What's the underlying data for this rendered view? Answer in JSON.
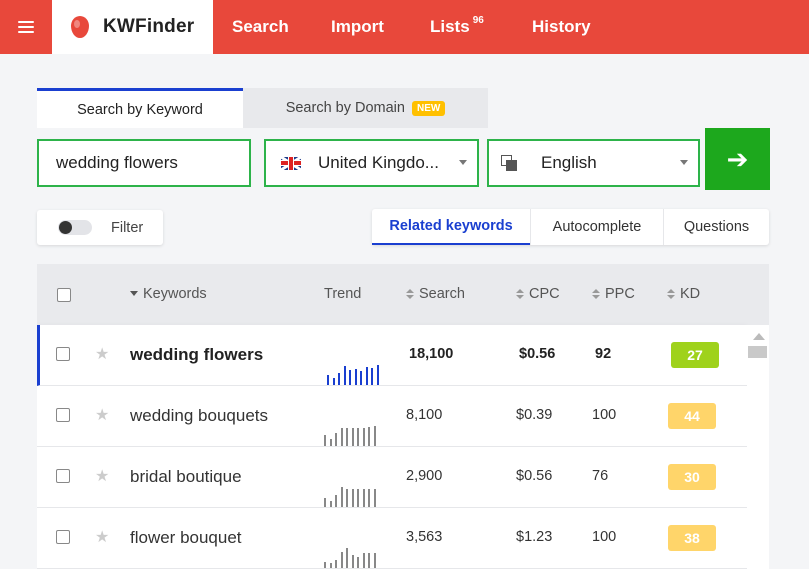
{
  "nav": {
    "brand": "KWFinder",
    "items": [
      {
        "label": "Search"
      },
      {
        "label": "Import"
      },
      {
        "label": "Lists",
        "badge": "96"
      },
      {
        "label": "History"
      }
    ]
  },
  "mode_tabs": {
    "by_keyword": "Search by Keyword",
    "by_domain": "Search by Domain",
    "new_badge": "NEW"
  },
  "search": {
    "keyword": "wedding flowers",
    "location": "United Kingdo...",
    "language": "English"
  },
  "filter": {
    "label": "Filter",
    "enabled": false
  },
  "type_tabs": [
    "Related keywords",
    "Autocomplete",
    "Questions"
  ],
  "table": {
    "headers": {
      "keywords": "Keywords",
      "trend": "Trend",
      "search": "Search",
      "cpc": "CPC",
      "ppc": "PPC",
      "kd": "KD"
    },
    "rows": [
      {
        "keyword": "wedding flowers",
        "search": "18,100",
        "cpc": "$0.56",
        "ppc": "92",
        "kd": "27",
        "kd_color": "#9fd21b",
        "trend": [
          10,
          7,
          12,
          19,
          15,
          16,
          14,
          18,
          17,
          20
        ],
        "trend_color": "#1a3fd0"
      },
      {
        "keyword": "wedding bouquets",
        "search": "8,100",
        "cpc": "$0.39",
        "ppc": "100",
        "kd": "44",
        "kd_color": "#ffd56a",
        "trend": [
          10,
          7,
          12,
          17,
          17,
          17,
          17,
          17,
          18,
          19
        ],
        "trend_color": "#888888"
      },
      {
        "keyword": "bridal boutique",
        "search": "2,900",
        "cpc": "$0.56",
        "ppc": "76",
        "kd": "30",
        "kd_color": "#ffd56a",
        "trend": [
          9,
          6,
          11,
          19,
          17,
          17,
          17,
          17,
          17,
          17
        ],
        "trend_color": "#888888"
      },
      {
        "keyword": "flower bouquet",
        "search": "3,563",
        "cpc": "$1.23",
        "ppc": "100",
        "kd": "38",
        "kd_color": "#ffd56a",
        "trend": [
          6,
          5,
          8,
          15,
          19,
          12,
          10,
          14,
          14,
          14
        ],
        "trend_color": "#888888"
      }
    ]
  },
  "colors": {
    "brand": "#e8483b",
    "accent_blue": "#1a3fd0",
    "go_green": "#1da81d",
    "field_border": "#2db34a"
  }
}
